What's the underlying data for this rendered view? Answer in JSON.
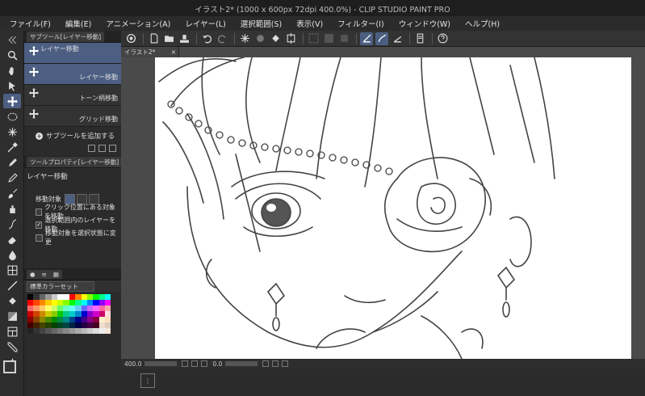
{
  "window": {
    "title": "イラスト2* (1000 x 600px 72dpi 400.0%) - CLIP STUDIO PAINT PRO"
  },
  "menubar": {
    "items": [
      "ファイル(F)",
      "編集(E)",
      "アニメーション(A)",
      "レイヤー(L)",
      "選択範囲(S)",
      "表示(V)",
      "フィルター(I)",
      "ウィンドウ(W)",
      "ヘルプ(H)"
    ]
  },
  "subtool_panel": {
    "tab_label": "サブツール[レイヤー移動]",
    "items": [
      {
        "label": "レイヤー移動",
        "selected": true
      },
      {
        "label": "レイヤー移動",
        "selected": true
      },
      {
        "label": "トーン柄移動",
        "selected": false
      },
      {
        "label": "グリッド移動",
        "selected": false
      }
    ],
    "add_label": "サブツールを追加する"
  },
  "tool_property_panel": {
    "tab_label": "ツールプロパティ[レイヤー移動]",
    "title": "レイヤー移動",
    "target_label": "移動対象",
    "options": [
      {
        "label": "クリック位置にある対象を移動",
        "checked": false
      },
      {
        "label": "選択範囲内のレイヤーを移動",
        "checked": true
      },
      {
        "label": "移動対象を選択状態に変更",
        "checked": false
      }
    ]
  },
  "color_set_panel": {
    "set_name": "標準カラーセット",
    "swatches": [
      "#000000",
      "#333333",
      "#666666",
      "#999999",
      "#cccccc",
      "#ffffff",
      "#ffffff",
      "#ff0000",
      "#ff8800",
      "#ffff00",
      "#88ff00",
      "#00ff00",
      "#00ff88",
      "#00ffff",
      "#ff0000",
      "#ff4400",
      "#ff8800",
      "#ffcc00",
      "#ffff00",
      "#ccff00",
      "#88ff00",
      "#00ff00",
      "#00ff88",
      "#00ffff",
      "#0088ff",
      "#0000ff",
      "#8800ff",
      "#ff00ff",
      "#ff6666",
      "#ff9966",
      "#ffcc66",
      "#ffff66",
      "#ccff66",
      "#66ff66",
      "#66ffcc",
      "#66ffff",
      "#66ccff",
      "#6666ff",
      "#cc66ff",
      "#ff66ff",
      "#ff66aa",
      "#ffaaaa",
      "#cc0000",
      "#cc4400",
      "#cc8800",
      "#cccc00",
      "#88cc00",
      "#00cc00",
      "#00cc88",
      "#00cccc",
      "#0088cc",
      "#0000cc",
      "#8800cc",
      "#cc00cc",
      "#cc0066",
      "#ffdddd",
      "#880000",
      "#884400",
      "#888800",
      "#448800",
      "#008800",
      "#008844",
      "#008888",
      "#004488",
      "#000088",
      "#440088",
      "#880088",
      "#880044",
      "#ffeecc",
      "#ffddbb",
      "#440000",
      "#442200",
      "#444400",
      "#224400",
      "#004400",
      "#004422",
      "#004444",
      "#002244",
      "#000044",
      "#220044",
      "#440044",
      "#440022",
      "#eeddcc",
      "#ddccbb",
      "#222222",
      "#333333",
      "#444444",
      "#555555",
      "#666666",
      "#777777",
      "#888888",
      "#999999",
      "#aaaaaa",
      "#bbbbbb",
      "#cccccc",
      "#dddddd",
      "#eeeeee",
      "#f5e6d8"
    ]
  },
  "document": {
    "tab_label": "イラスト2*"
  },
  "status": {
    "zoom": "400.0",
    "angle": "0.0"
  },
  "colors": {
    "accent": "#4c5f82",
    "panel_bg": "#2b2b2b",
    "title_bg": "#1e1e1e"
  }
}
